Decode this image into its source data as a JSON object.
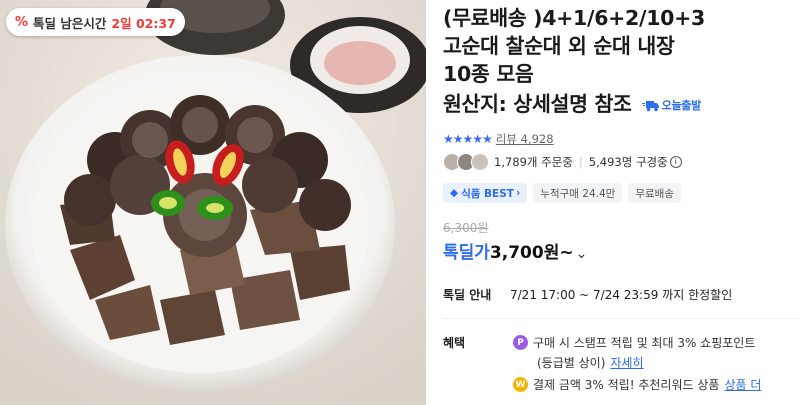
{
  "deal_badge": {
    "icon": "percent-icon",
    "label": "톡딜 남은시간",
    "time": "2일 02:37"
  },
  "product": {
    "title_lines": [
      "(무료배송 )4+1/6+2/10+3",
      "고순대 찰순대 외 순대 내장",
      "10종 모음"
    ],
    "origin": "원산지: 상세설명 참조",
    "delivery_badge": "오늘출발"
  },
  "rating": {
    "stars": "★★★★★",
    "review_label": "리뷰",
    "review_count": "4,928"
  },
  "social": {
    "orders": "1,789개 주문중",
    "viewers": "5,493명 구경중"
  },
  "tags": [
    "식품 BEST",
    "누적구매 24.4만",
    "무료배송"
  ],
  "price": {
    "original": "6,300원",
    "label": "톡딜가",
    "value": "3,700원~"
  },
  "deal_info": {
    "label": "톡딜 안내",
    "text": "7/21 17:00 ~ 7/24 23:59 까지 한정할인"
  },
  "benefit": {
    "label": "혜택",
    "line1": "구매 시 스탬프 적립 및 최대 3% 쇼핑포인트",
    "line2_prefix": "(등급별 상이)",
    "line2_link": "자세히",
    "line3": "결제 금액 3% 적립! 추천리워드 상품",
    "line3_link": "상품 더"
  },
  "colors": {
    "accent_blue": "#2b6cf2",
    "deal_red": "#f23a3a",
    "star_blue": "#3b6df0"
  }
}
